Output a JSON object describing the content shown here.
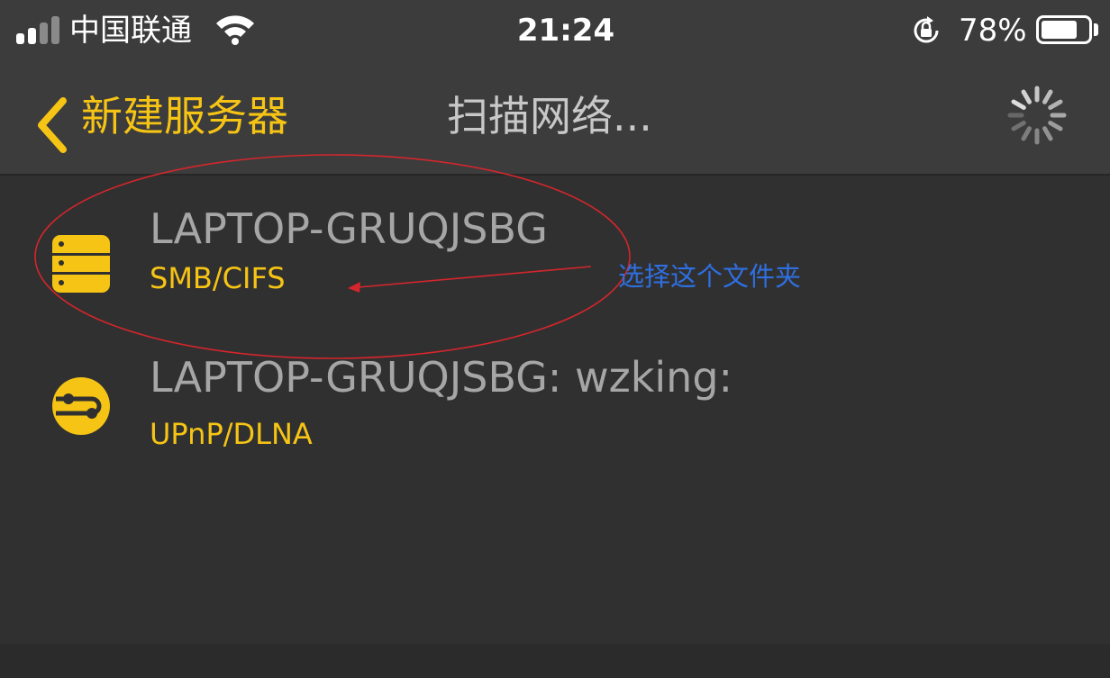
{
  "status_bar": {
    "carrier": "中国联通",
    "time": "21:24",
    "battery_percent": "78%",
    "battery_level": 0.78,
    "signal_bars_active": 2,
    "signal_bars_total": 4
  },
  "nav": {
    "back_label": "新建服务器",
    "title": "扫描网络...",
    "back_icon": "chevron-left-icon",
    "spinner_icon": "loading-spinner-icon"
  },
  "servers": [
    {
      "name": "LAPTOP-GRUQJSBG",
      "protocol": "SMB/CIFS",
      "icon": "server-rack-icon"
    },
    {
      "name": "LAPTOP-GRUQJSBG: wzking:",
      "protocol": "UPnP/DLNA",
      "icon": "upnp-network-icon"
    }
  ],
  "annotation": {
    "text": "选择这个文件夹",
    "color": "#2f6fe0",
    "mark_color": "#d4262c"
  },
  "colors": {
    "accent": "#f6c415",
    "header_bg": "#3c3c3c",
    "list_bg": "#303030",
    "primary_text": "#a6a6a6",
    "title_text": "#c8c8c8"
  }
}
